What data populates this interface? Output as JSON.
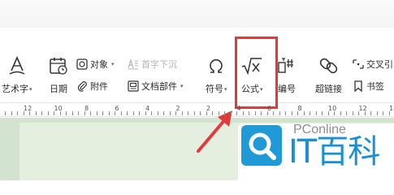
{
  "ribbon": {
    "wordart": {
      "label": "艺术字",
      "icon": "wordart-icon"
    },
    "date": {
      "label": "日期",
      "icon": "calendar-icon"
    },
    "object": {
      "label": "对象",
      "icon": "object-icon"
    },
    "attachment": {
      "label": "附件",
      "icon": "paperclip-icon"
    },
    "drop_cap": {
      "label": "首字下沉",
      "icon": "drop-cap-icon"
    },
    "doc_parts": {
      "label": "文档部件",
      "icon": "document-parts-icon"
    },
    "symbol": {
      "label": "符号",
      "icon": "omega-icon"
    },
    "formula": {
      "label": "公式",
      "icon": "formula-sqrt-icon"
    },
    "numbering": {
      "label": "编号",
      "icon": "numbering-icon"
    },
    "hyperlink": {
      "label": "超链接",
      "icon": "link-icon"
    },
    "cross_ref": {
      "label": "交叉引",
      "icon": "cross-reference-icon"
    },
    "bookmark": {
      "label": "书签",
      "icon": "bookmark-icon"
    }
  },
  "ruler": {
    "numbers": [
      "12",
      "10",
      "8",
      "6",
      "4",
      "2",
      "2",
      "4",
      "6",
      "8",
      "10",
      "12",
      "14"
    ]
  },
  "watermark": {
    "brand": "PConline",
    "text": "IT百科"
  },
  "colors": {
    "highlight": "#e03a3a",
    "doc_background": "#d4e3cf",
    "watermark_blue": "#1e9ad6"
  }
}
